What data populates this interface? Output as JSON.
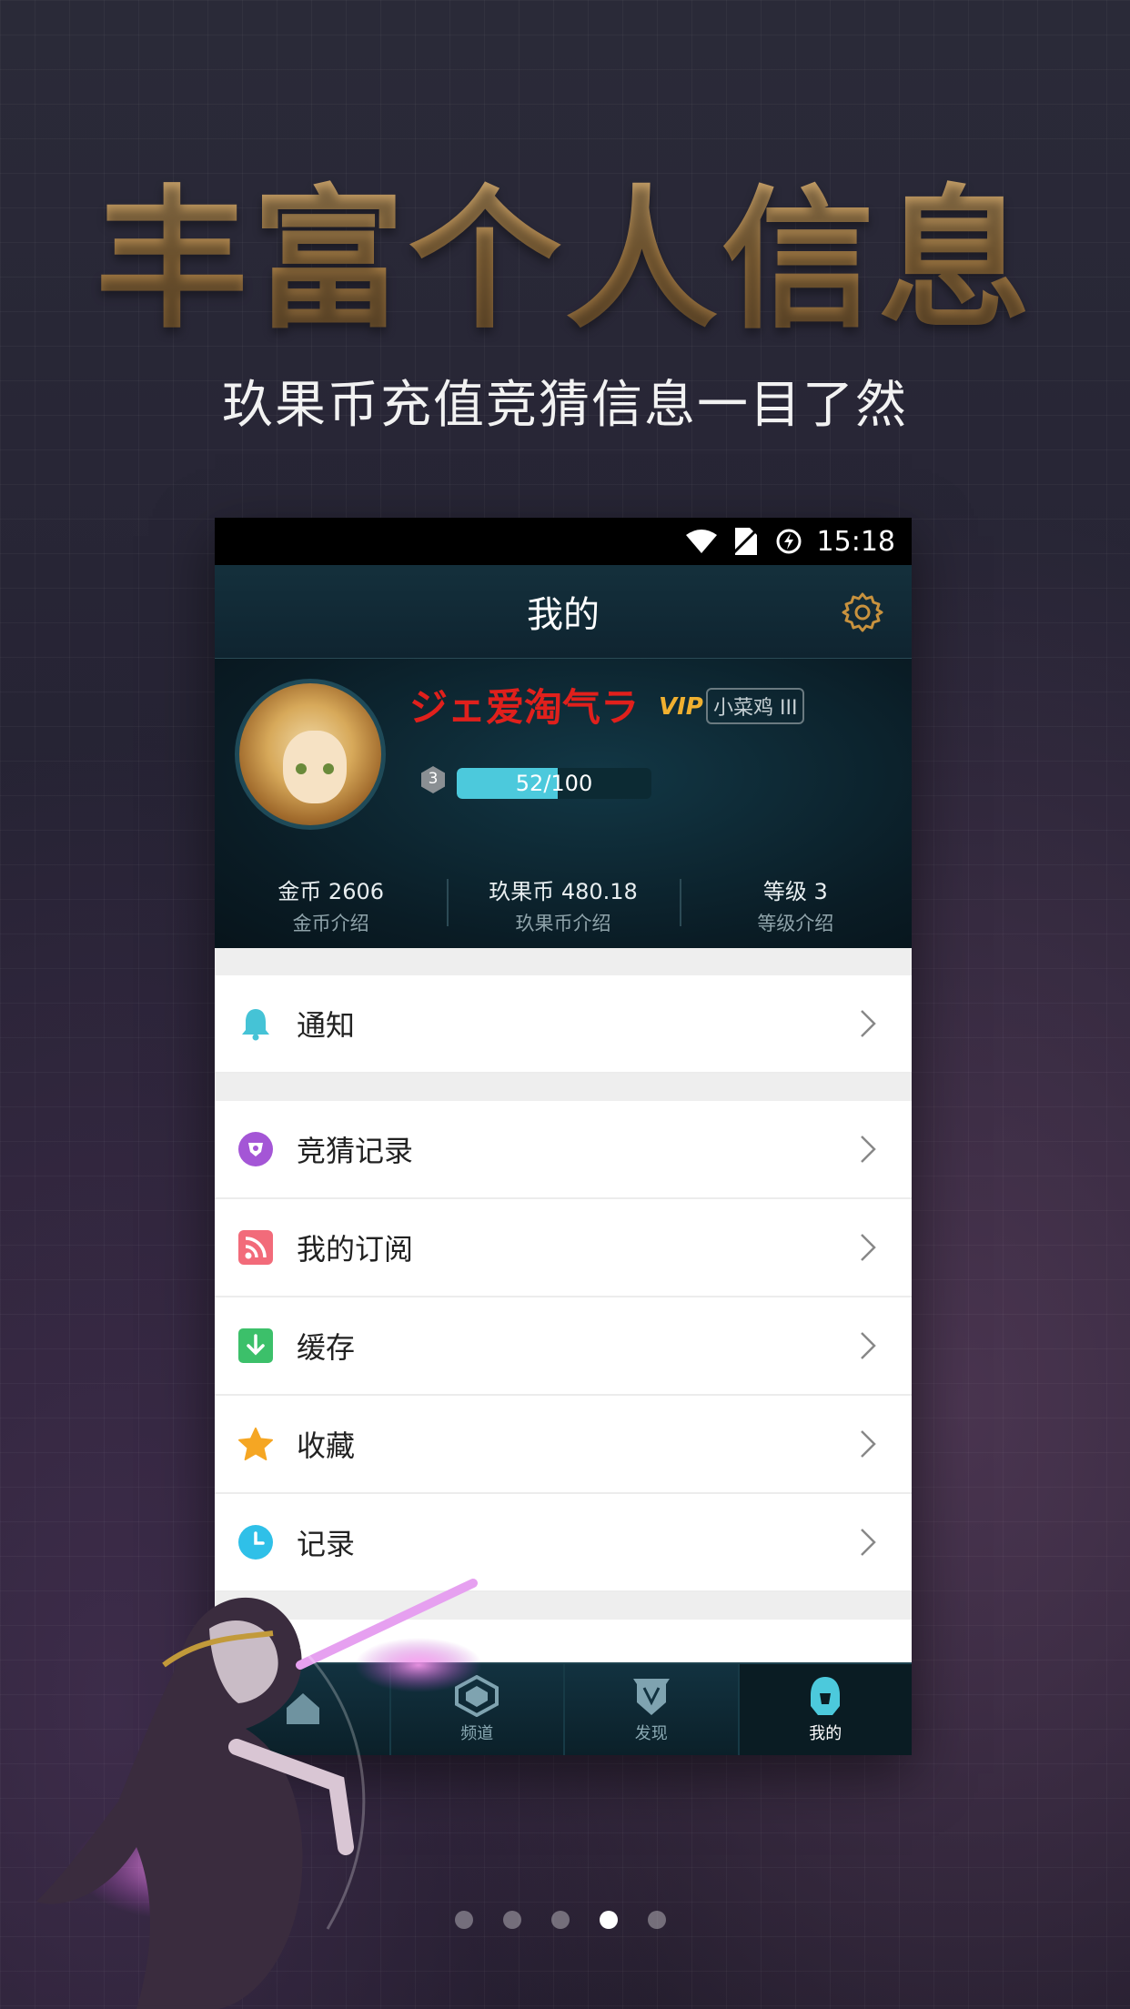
{
  "headline": "丰富个人信息",
  "subline": "玖果币充值竞猜信息一目了然",
  "statusbar": {
    "time": "15:18"
  },
  "appbar": {
    "title": "我的"
  },
  "profile": {
    "username": "ジェ爱淘气ラ",
    "vip": "VIP",
    "rank": "小菜鸡 III",
    "level_badge": "3",
    "xp_text": "52/100",
    "xp_fraction": 0.52,
    "username_color": "#e0201c"
  },
  "stats": [
    {
      "value": "金币 2606",
      "label": "金币介绍"
    },
    {
      "value": "玖果币 480.18",
      "label": "玖果币介绍"
    },
    {
      "value": "等级 3",
      "label": "等级介绍"
    }
  ],
  "menu": {
    "notify": {
      "label": "通知",
      "icon": "bell-icon",
      "color": "#45c3d6"
    },
    "items": [
      {
        "label": "竞猜记录",
        "icon": "shield-bet-icon",
        "color": "#a456d6"
      },
      {
        "label": "我的订阅",
        "icon": "rss-icon",
        "color": "#f26b7a"
      },
      {
        "label": "缓存",
        "icon": "download-icon",
        "color": "#3cc06a"
      },
      {
        "label": "收藏",
        "icon": "star-icon",
        "color": "#f5a623"
      },
      {
        "label": "记录",
        "icon": "clock-icon",
        "color": "#2fc0e8"
      }
    ]
  },
  "tabs": [
    {
      "label": "",
      "icon": "home-icon"
    },
    {
      "label": "频道",
      "icon": "channel-icon"
    },
    {
      "label": "发现",
      "icon": "discover-icon"
    },
    {
      "label": "我的",
      "icon": "profile-helmet-icon",
      "active": true
    }
  ],
  "pager": {
    "count": 5,
    "active": 3
  }
}
